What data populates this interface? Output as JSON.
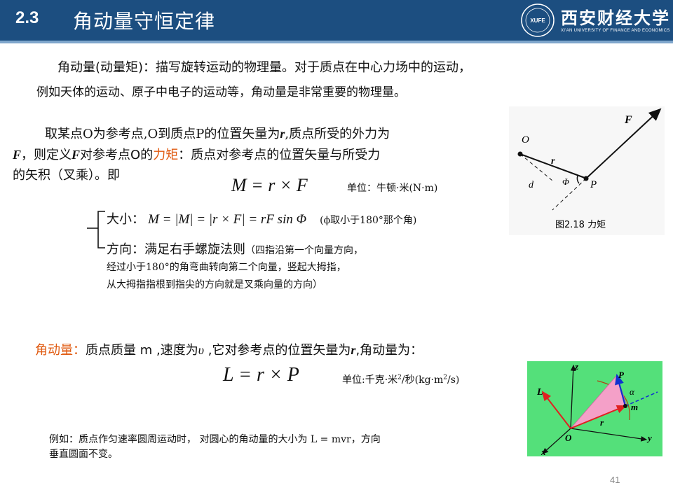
{
  "header": {
    "section_number": "2.3",
    "title": "角动量守恒定律",
    "logo_cn": "西安财经大学",
    "logo_en": "XI'AN UNIVERSITY OF FINANCE AND ECONOMICS",
    "logo_seal_text": "XUFE"
  },
  "intro": {
    "bold_part": "角动量(动量矩)：描写旋转运动的物理量。",
    "rest_line1": "对于质点在中心力场中的运动，",
    "line2": "例如天体的运动、原子中电子的运动等，角动量是非常重要的物理量。"
  },
  "torque": {
    "line1": "取某点O为参考点,O到质点P的位置矢量为",
    "line1_var": "r",
    "line1_end": ",质点所受的外力为",
    "line2_var": "F",
    "line2_a": "，则定义",
    "line2_var2": "F",
    "line2_b": "对参考点O的",
    "line2_red": "力矩",
    "line2_c": "：质点对参考点的位置矢量与所受力",
    "line3": "的矢积（叉乘）。即",
    "formula": "M = r × F",
    "unit": "单位：牛顿·米(N·m)",
    "magnitude_label": "大小：",
    "magnitude_formula": "M = |M| = |r × F| = rF sin Φ",
    "magnitude_note": "(ϕ取小于180°那个角)",
    "direction_label": "方向：满足右手螺旋法则",
    "direction_note1": "（四指沿第一个向量方向，",
    "direction_note2": "经过小于180°的角弯曲转向第二个向量，竖起大拇指，",
    "direction_note3": "从大拇指指根到指尖的方向就是叉乘向量的方向）"
  },
  "angular": {
    "red_label": "角动量：",
    "text_a": "质点质量 m ,速度为",
    "velocity_symbol": "υ",
    "text_b": " ,它对参考点的位置矢量为",
    "var_r": "r",
    "text_c": ",角动量为：",
    "formula": "L = r × P",
    "unit_a": "单位:千克·米",
    "unit_sup": "2",
    "unit_b": "/秒(kg·m",
    "unit_sup2": "2",
    "unit_c": "/s)"
  },
  "example": {
    "line1": "例如：质点作匀速率圆周运动时， 对圆心的角动量的大小为 L = mvr，方向",
    "line2": "垂直圆面不变。"
  },
  "figure1": {
    "caption": "图2.18  力矩",
    "label_O": "O",
    "label_P": "P",
    "label_F": "F",
    "label_r": "r",
    "label_d": "d",
    "label_phi": "Φ"
  },
  "figure2": {
    "label_z": "z",
    "label_y": "y",
    "label_x": "x",
    "label_O": "O",
    "label_L": "L",
    "label_P": "P",
    "label_r": "r",
    "label_m": "m",
    "label_alpha": "α"
  },
  "page_number": "41",
  "colors": {
    "header_bg": "#1c4e80",
    "accent_red": "#e05a10",
    "figure2_bg": "#54e07a"
  }
}
